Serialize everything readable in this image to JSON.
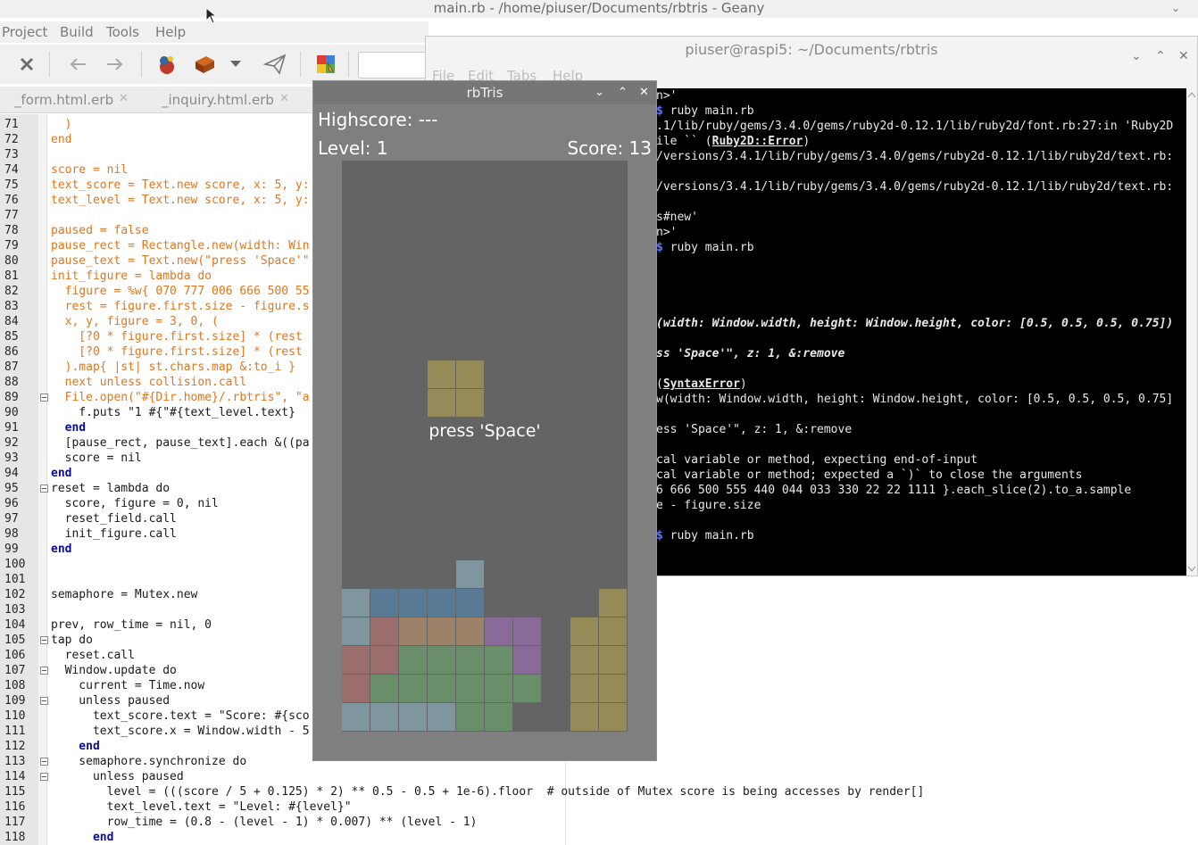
{
  "geany": {
    "title": "main.rb - /home/piuser/Documents/rbtris - Geany",
    "menu": [
      "Project",
      "Build",
      "Tools",
      "Help"
    ],
    "tabs": [
      "_form.html.erb",
      "_inquiry.html.erb"
    ],
    "lines": [
      {
        "n": "71",
        "t": "  )",
        "c": "o"
      },
      {
        "n": "72",
        "t": "end",
        "c": "o"
      },
      {
        "n": "73",
        "t": "",
        "c": "o"
      },
      {
        "n": "74",
        "t": "score = nil",
        "c": "o"
      },
      {
        "n": "75",
        "t": "text_score = Text.new score, x: 5, y:",
        "c": "o"
      },
      {
        "n": "76",
        "t": "text_level = Text.new score, x: 5, y:",
        "c": "o"
      },
      {
        "n": "77",
        "t": "",
        "c": "o"
      },
      {
        "n": "78",
        "t": "paused = false",
        "c": "o"
      },
      {
        "n": "79",
        "t": "pause_rect = Rectangle.new(width: Win",
        "c": "o"
      },
      {
        "n": "80",
        "t": "pause_text = Text.new(\"press 'Space'\"",
        "c": "o"
      },
      {
        "n": "81",
        "t": "init_figure = lambda do",
        "c": "o"
      },
      {
        "n": "82",
        "t": "  figure = %w{ 070 777 006 666 500 55",
        "c": "o"
      },
      {
        "n": "83",
        "t": "  rest = figure.first.size - figure.s",
        "c": "o"
      },
      {
        "n": "84",
        "t": "  x, y, figure = 3, 0, (",
        "c": "o"
      },
      {
        "n": "85",
        "t": "    [?0 * figure.first.size] * (rest",
        "c": "o"
      },
      {
        "n": "86",
        "t": "    [?0 * figure.first.size] * (rest",
        "c": "o"
      },
      {
        "n": "87",
        "t": "  ).map{ |st| st.chars.map &:to_i }",
        "c": "o"
      },
      {
        "n": "88",
        "t": "  next unless collision.call",
        "c": "o"
      },
      {
        "n": "89",
        "t": "  File.open(\"#{Dir.home}/.rbtris\", \"a",
        "c": "o",
        "fold": true
      },
      {
        "n": "90",
        "t": "    f.puts \"1 #{\"#{text_level.text}",
        "c": "d"
      },
      {
        "n": "91",
        "t": "  end",
        "c": "k"
      },
      {
        "n": "92",
        "t": "  [pause_rect, pause_text].each &((pa",
        "c": "d"
      },
      {
        "n": "93",
        "t": "  score = nil",
        "c": "d"
      },
      {
        "n": "94",
        "t": "end",
        "c": "k"
      },
      {
        "n": "95",
        "t": "reset = lambda do",
        "c": "d",
        "fold": true
      },
      {
        "n": "96",
        "t": "  score, figure = 0, nil",
        "c": "d"
      },
      {
        "n": "97",
        "t": "  reset_field.call",
        "c": "d"
      },
      {
        "n": "98",
        "t": "  init_figure.call",
        "c": "d"
      },
      {
        "n": "99",
        "t": "end",
        "c": "k"
      },
      {
        "n": "100",
        "t": "",
        "c": "d"
      },
      {
        "n": "101",
        "t": "",
        "c": "d"
      },
      {
        "n": "102",
        "t": "semaphore = Mutex.new",
        "c": "d"
      },
      {
        "n": "103",
        "t": "",
        "c": "d"
      },
      {
        "n": "104",
        "t": "prev, row_time = nil, 0",
        "c": "d"
      },
      {
        "n": "105",
        "t": "tap do",
        "c": "d",
        "fold": true
      },
      {
        "n": "106",
        "t": "  reset.call",
        "c": "d"
      },
      {
        "n": "107",
        "t": "  Window.update do",
        "c": "d",
        "fold": true
      },
      {
        "n": "108",
        "t": "    current = Time.now",
        "c": "d"
      },
      {
        "n": "109",
        "t": "    unless paused",
        "c": "d",
        "fold": true
      },
      {
        "n": "110",
        "t": "      text_score.text = \"Score: #{sco",
        "c": "d"
      },
      {
        "n": "111",
        "t": "      text_score.x = Window.width - 5",
        "c": "d"
      },
      {
        "n": "112",
        "t": "    end",
        "c": "k"
      },
      {
        "n": "113",
        "t": "    semaphore.synchronize do",
        "c": "d",
        "fold": true
      },
      {
        "n": "114",
        "t": "      unless paused",
        "c": "d",
        "fold": true
      },
      {
        "n": "115",
        "t": "        level = (((score / 5 + 0.125) * 2) ** 0.5 - 0.5 + 1e-6).floor  # outside of Mutex score is being accesses by render[]",
        "c": "d"
      },
      {
        "n": "116",
        "t": "        text_level.text = \"Level: #{level}\"",
        "c": "d"
      },
      {
        "n": "117",
        "t": "        row_time = (0.8 - (level - 1) * 0.007) ** (level - 1)",
        "c": "d"
      },
      {
        "n": "118",
        "t": "      end",
        "c": "k"
      }
    ]
  },
  "terminal": {
    "title": "piuser@raspi5: ~/Documents/rbtris",
    "menu": [
      "File",
      "Edit",
      "Tabs",
      "Help"
    ],
    "lines": [
      {
        "t": "n>'",
        "s": ""
      },
      {
        "t": "$ ruby main.rb",
        "s": "prompt"
      },
      {
        "t": ".1/lib/ruby/gems/3.4.0/gems/ruby2d-0.12.1/lib/ruby2d/font.rb:27:in 'Ruby2D",
        "s": ""
      },
      {
        "t": "ile `` (Ruby2D::Error)",
        "s": "err"
      },
      {
        "t": "/versions/3.4.1/lib/ruby/gems/3.4.0/gems/ruby2d-0.12.1/lib/ruby2d/text.rb:",
        "s": ""
      },
      {
        "t": "",
        "s": ""
      },
      {
        "t": "/versions/3.4.1/lib/ruby/gems/3.4.0/gems/ruby2d-0.12.1/lib/ruby2d/text.rb:",
        "s": ""
      },
      {
        "t": "",
        "s": ""
      },
      {
        "t": "s#new'",
        "s": ""
      },
      {
        "t": "n>'",
        "s": ""
      },
      {
        "t": "$ ruby main.rb",
        "s": "prompt"
      },
      {
        "t": "",
        "s": ""
      },
      {
        "t": "",
        "s": ""
      },
      {
        "t": "",
        "s": ""
      },
      {
        "t": "",
        "s": ""
      },
      {
        "t": "(width: Window.width, height: Window.height, color: [0.5, 0.5, 0.5, 0.75])",
        "s": "bi"
      },
      {
        "t": "",
        "s": ""
      },
      {
        "t": "ss 'Space'\", z: 1, &:remove",
        "s": "bi"
      },
      {
        "t": "",
        "s": ""
      },
      {
        "t": "(SyntaxError)",
        "s": "syn"
      },
      {
        "t": "w(width: Window.width, height: Window.height, color: [0.5, 0.5, 0.5, 0.75]",
        "s": ""
      },
      {
        "t": "",
        "s": ""
      },
      {
        "t": "ess 'Space'\", z: 1, &:remove",
        "s": ""
      },
      {
        "t": "",
        "s": ""
      },
      {
        "t": "cal variable or method, expecting end-of-input",
        "s": ""
      },
      {
        "t": "cal variable or method; expected a `)` to close the arguments",
        "s": ""
      },
      {
        "t": "6 666 500 555 440 044 033 330 22 22 1111 }.each_slice(2).to_a.sample",
        "s": ""
      },
      {
        "t": "e - figure.size",
        "s": ""
      },
      {
        "t": "",
        "s": ""
      },
      {
        "t": "$ ruby main.rb",
        "s": "prompt"
      }
    ]
  },
  "rbtris": {
    "title": "rbTris",
    "highscore": "Highscore: ---",
    "level": "Level: 1",
    "score": "Score: 13",
    "pause_text": "press 'Space'",
    "colors": {
      "S": "#7f969e",
      "B": "#587a95",
      "R": "#9b6e6e",
      "O": "#9d826a",
      "P": "#8a6a98",
      "G": "#6a8e6a",
      "Y": "#958a58"
    },
    "board": [
      "..........",
      "..........",
      "..........",
      "..........",
      "..........",
      "..........",
      "..........",
      "..........",
      "..........",
      "..........",
      "..........",
      "..........",
      "..........",
      "..........",
      "....S.....",
      "SBBBB....Y",
      "SROOOPP.YY",
      "RRGGGGP.YY",
      "RGGGGGG.YY",
      "SSSSGG..YY"
    ],
    "piece": {
      "color": "Y",
      "cells": [
        [
          3,
          7
        ],
        [
          4,
          7
        ],
        [
          3,
          8
        ],
        [
          4,
          8
        ]
      ]
    }
  }
}
